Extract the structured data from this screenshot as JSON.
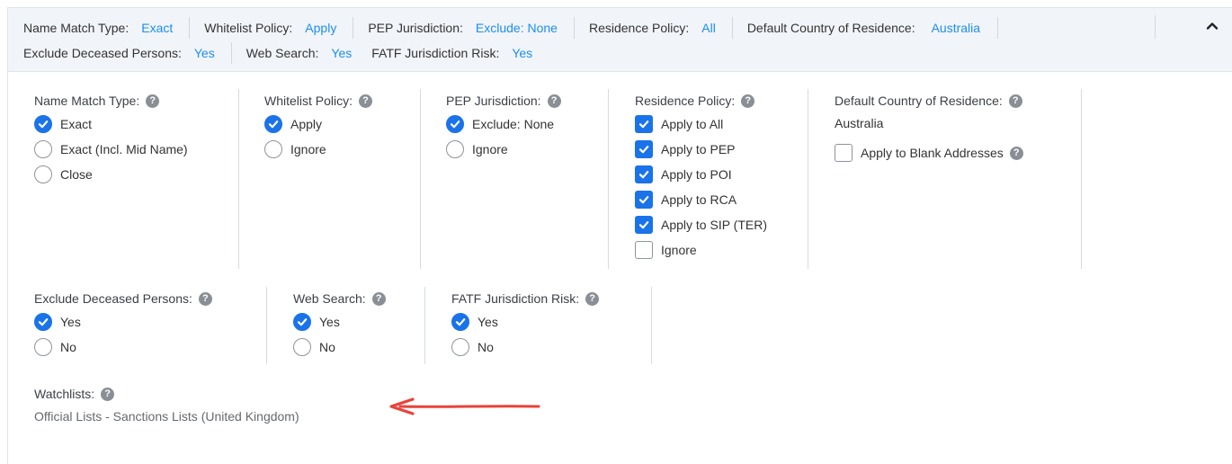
{
  "summary": {
    "row1": [
      {
        "label": "Name Match Type:",
        "value": "Exact"
      },
      {
        "label": "Whitelist Policy:",
        "value": "Apply"
      },
      {
        "label": "PEP Jurisdiction:",
        "value": "Exclude: None"
      },
      {
        "label": "Residence Policy:",
        "value": "All"
      },
      {
        "label": "Default Country of Residence:",
        "value": "Australia"
      }
    ],
    "row2": [
      {
        "label": "Exclude Deceased Persons:",
        "value": "Yes"
      },
      {
        "label": "Web Search:",
        "value": "Yes"
      },
      {
        "label": "FATF Jurisdiction Risk:",
        "value": "Yes"
      }
    ]
  },
  "help_glyph": "?",
  "name_match": {
    "label": "Name Match Type:",
    "options": [
      "Exact",
      "Exact (Incl. Mid Name)",
      "Close"
    ],
    "selected": 0
  },
  "whitelist": {
    "label": "Whitelist Policy:",
    "options": [
      "Apply",
      "Ignore"
    ],
    "selected": 0
  },
  "pep": {
    "label": "PEP Jurisdiction:",
    "options": [
      "Exclude: None",
      "Ignore"
    ],
    "selected": 0
  },
  "residence": {
    "label": "Residence Policy:",
    "options": [
      "Apply to All",
      "Apply to PEP",
      "Apply to POI",
      "Apply to RCA",
      "Apply to SIP (TER)",
      "Ignore"
    ],
    "checked": [
      true,
      true,
      true,
      true,
      true,
      false
    ]
  },
  "country": {
    "label": "Default Country of Residence:",
    "value": "Australia",
    "blank_label": "Apply to Blank Addresses",
    "blank_checked": false
  },
  "deceased": {
    "label": "Exclude Deceased Persons:",
    "options": [
      "Yes",
      "No"
    ],
    "selected": 0
  },
  "web_search": {
    "label": "Web Search:",
    "options": [
      "Yes",
      "No"
    ],
    "selected": 0
  },
  "fatf": {
    "label": "FATF Jurisdiction Risk:",
    "options": [
      "Yes",
      "No"
    ],
    "selected": 0
  },
  "watchlists": {
    "label": "Watchlists:",
    "value": "Official Lists - Sanctions Lists (United Kingdom)"
  },
  "colors": {
    "accent": "#1a73e8",
    "summary_value": "#1d8ff0",
    "annotation_arrow": "#e8433a"
  },
  "icons": {
    "collapse": "chevron-up-icon",
    "help": "help-icon",
    "check": "check-icon",
    "arrow": "red-arrow-annotation"
  }
}
